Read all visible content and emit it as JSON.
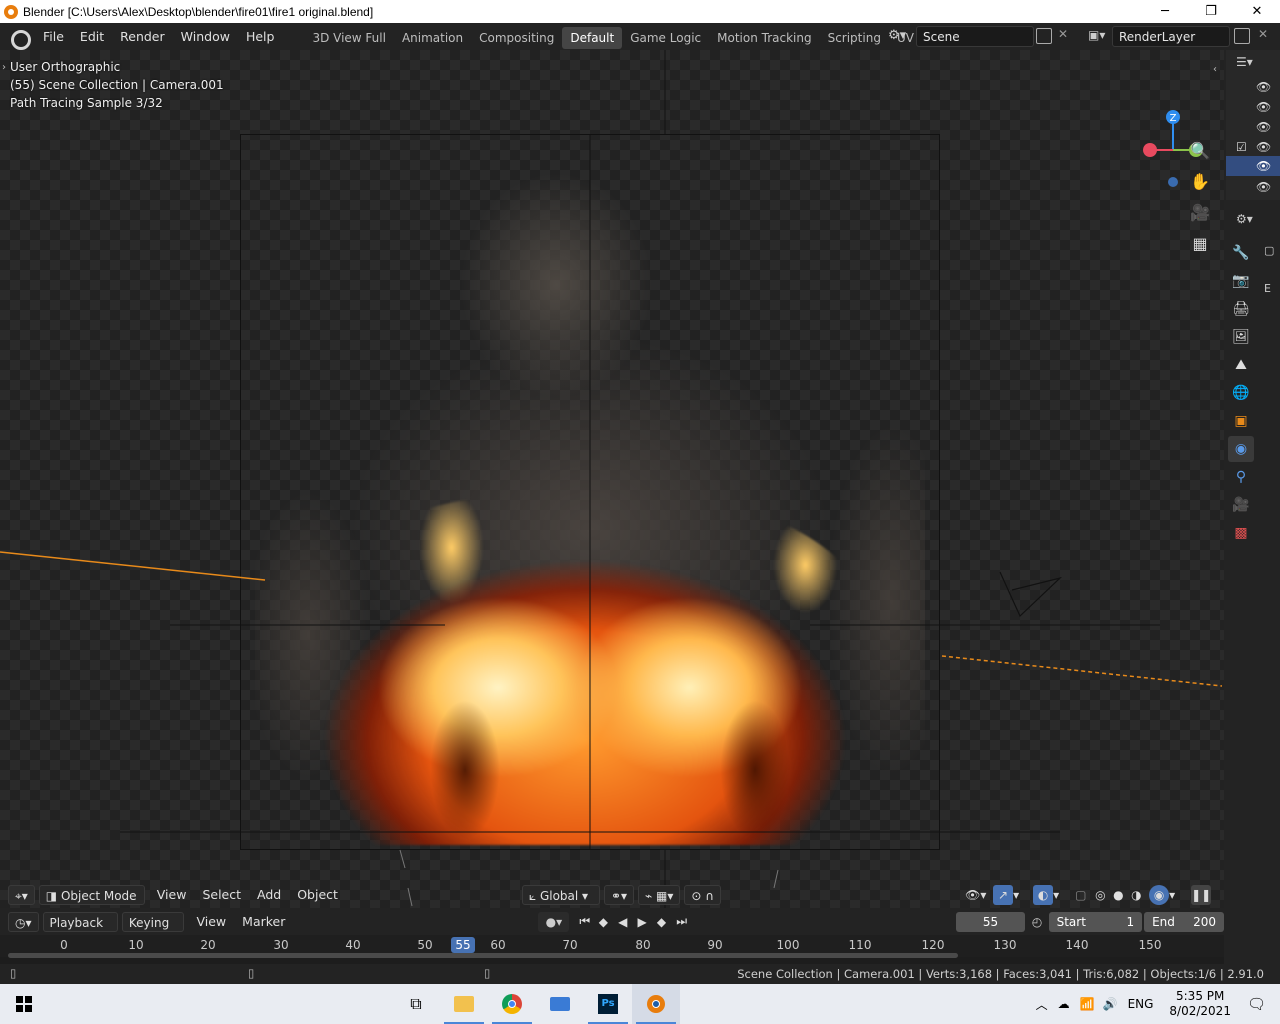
{
  "window": {
    "title": "Blender [C:\\Users\\Alex\\Desktop\\blender\\fire01\\fire1 original.blend]",
    "controls": [
      "─",
      "❐",
      "✕"
    ]
  },
  "menu": [
    "File",
    "Edit",
    "Render",
    "Window",
    "Help"
  ],
  "workspaces": {
    "tabs": [
      "3D View Full",
      "Animation",
      "Compositing",
      "Default",
      "Game Logic",
      "Motion Tracking",
      "Scripting",
      "UV Editing",
      "V"
    ],
    "active": "Default"
  },
  "scene": {
    "name": "Scene",
    "render_layer": "RenderLayer"
  },
  "viewport": {
    "view_name": "User Orthographic",
    "collection_info": "(55) Scene Collection | Camera.001",
    "render_progress": "Path Tracing Sample 3/32",
    "gizmo": {
      "z": "Z",
      "x_color": "#e84a5f",
      "y_color": "#8bc34a",
      "z_color": "#2f8ef0"
    }
  },
  "viewport_header": {
    "mode": "Object Mode",
    "menus": [
      "View",
      "Select",
      "Add",
      "Object"
    ],
    "transform_orientation": "Global"
  },
  "timeline": {
    "menus": [
      "Playback",
      "Keying",
      "View",
      "Marker"
    ],
    "current_frame": "55",
    "start_label": "Start",
    "start": "1",
    "end_label": "End",
    "end": "200",
    "ticks": [
      "0",
      "10",
      "20",
      "30",
      "40",
      "50",
      "60",
      "70",
      "80",
      "90",
      "100",
      "110",
      "120",
      "130",
      "140",
      "150"
    ],
    "cursor_frame": "55"
  },
  "status": {
    "stats": "Scene Collection | Camera.001 | Verts:3,168 | Faces:3,041 | Tris:6,082 | Objects:1/6 | 2.91.0"
  },
  "taskbar": {
    "apps": [
      "start-icon",
      "task-view-icon",
      "file-explorer-icon",
      "chrome-icon",
      "desktop-app-icon",
      "photoshop-icon",
      "blender-icon"
    ],
    "photoshop_label": "Ps",
    "language": "ENG",
    "time": "5:35 PM",
    "date": "8/02/2021"
  }
}
